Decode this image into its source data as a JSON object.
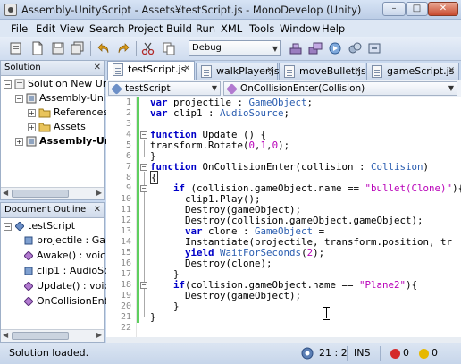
{
  "window": {
    "title": "Assembly-UnityScript - Assets¥testScript.js - MonoDevelop (Unity)",
    "minimize": "–",
    "maximize": "□",
    "close": "✕"
  },
  "menu": [
    "File",
    "Edit",
    "View",
    "Search",
    "Project",
    "Build",
    "Run",
    "XML",
    "Tools",
    "Window",
    "Help"
  ],
  "toolbar": {
    "configuration": "Debug",
    "icons": [
      "new-solution-icon",
      "new-file-icon",
      "save-icon",
      "save-all-icon",
      "undo-icon",
      "redo-icon",
      "cut-icon",
      "copy-icon",
      "paste-icon",
      "build-icon",
      "rebuild-icon",
      "run-icon",
      "debug-icon",
      "attach-icon"
    ]
  },
  "solution_panel": {
    "title": "Solution",
    "items": [
      {
        "label": "Solution New Uni",
        "level": 0,
        "expander": "−"
      },
      {
        "label": "Assembly-Unity",
        "level": 1,
        "expander": "−"
      },
      {
        "label": "References",
        "level": 2,
        "expander": "+"
      },
      {
        "label": "Assets",
        "level": 2,
        "expander": "+"
      },
      {
        "label": "Assembly-Unit",
        "level": 1,
        "expander": "+",
        "bold": true
      }
    ]
  },
  "outline_panel": {
    "title": "Document Outline",
    "items": [
      {
        "label": "testScript",
        "level": 0,
        "expander": "−"
      },
      {
        "label": "projectile : Ga",
        "level": 1
      },
      {
        "label": "Awake() : voic",
        "level": 1
      },
      {
        "label": "clip1 : AudioSc",
        "level": 1
      },
      {
        "label": "Update() : voic",
        "level": 1
      },
      {
        "label": "OnCollisionEnte",
        "level": 1
      }
    ]
  },
  "tabs": [
    {
      "label": "testScript.js",
      "active": true
    },
    {
      "label": "walkPlayer.js",
      "active": false
    },
    {
      "label": "moveBullet.js",
      "active": false
    },
    {
      "label": "gameScript.js",
      "active": false
    }
  ],
  "pathbar": {
    "class": "testScript",
    "member": "OnCollisionEnter(Collision)"
  },
  "code_lines": [
    "var projectile : GameObject;",
    "var clip1 : AudioSource;",
    "",
    "function Update () {",
    "transform.Rotate(0,1,0);",
    "}",
    "function OnCollisionEnter(collision : Collision)",
    "{",
    "    if (collision.gameObject.name == \"bullet(Clone)\"){",
    "      clip1.Play();",
    "      Destroy(gameObject);",
    "      Destroy(collision.gameObject.gameObject);",
    "      var clone : GameObject =",
    "      Instantiate(projectile, transform.position, tr",
    "      yield WaitForSeconds(2);",
    "      Destroy(clone);",
    "    }",
    "    if(collision.gameObject.name == \"Plane2\"){",
    "      Destroy(gameObject);",
    "    }",
    "}",
    ""
  ],
  "status": {
    "message": "Solution loaded.",
    "position": "21 : 2",
    "mode": "INS",
    "errors": "0",
    "warnings": "0"
  }
}
